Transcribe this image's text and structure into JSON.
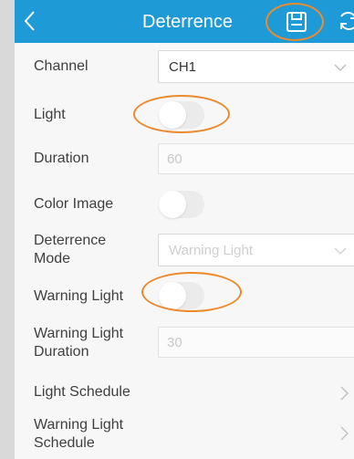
{
  "header": {
    "title": "Deterrence",
    "back_icon": "back-chevron-icon",
    "save_icon": "save-icon",
    "refresh_icon": "refresh-icon",
    "background": "#1e9ad6"
  },
  "annotation_color": "#ec8a2e",
  "settings": {
    "channel": {
      "label": "Channel",
      "value": "CH1"
    },
    "light": {
      "label": "Light",
      "enabled": false
    },
    "duration": {
      "label": "Duration",
      "placeholder": "60"
    },
    "color_image": {
      "label": "Color Image",
      "enabled": false
    },
    "deterrence_mode": {
      "label_line1": "Deterrence",
      "label_line2": "Mode",
      "placeholder": "Warning Light"
    },
    "warning_light": {
      "label": "Warning Light",
      "enabled": false
    },
    "warning_light_duration": {
      "label_line1": "Warning Light",
      "label_line2": "Duration",
      "placeholder": "30"
    },
    "light_schedule": {
      "label": "Light Schedule"
    },
    "warning_light_schedule": {
      "label_line1": "Warning Light",
      "label_line2": "Schedule"
    }
  }
}
